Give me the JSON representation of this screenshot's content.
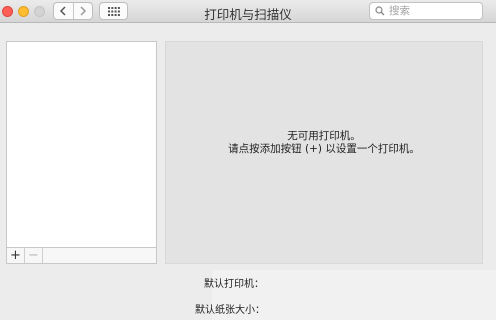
{
  "window": {
    "title": "打印机与扫描仪"
  },
  "search": {
    "placeholder": "搜索"
  },
  "list_toolbar": {
    "add_label": "+",
    "remove_label": "−"
  },
  "detail": {
    "message_line1": "无可用打印机。",
    "message_line2": "请点按添加按钮 (+) 以设置一个打印机。"
  },
  "footer": {
    "default_printer_label": "默认打印机：",
    "default_paper_label": "默认纸张大小："
  },
  "icons": {
    "close": "close-icon",
    "minimize": "minimize-icon",
    "maximize": "maximize-icon",
    "back": "chevron-left-icon",
    "forward": "chevron-right-icon",
    "show_all": "grid-icon",
    "search": "search-icon"
  },
  "colors": {
    "close": "#ff5f57",
    "minimize": "#febc2e",
    "maximize_disabled": "#d3d3d3",
    "detail_background": "#e3e3e3"
  }
}
